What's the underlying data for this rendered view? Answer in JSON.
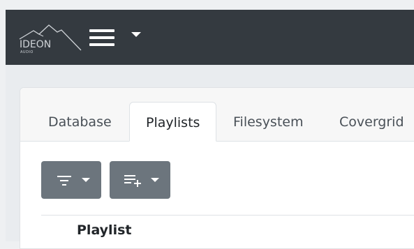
{
  "app": {
    "logo_text": "IDEON",
    "logo_subtext": "AUDIO"
  },
  "navbar": {
    "menu_icon": "hamburger-menu-icon",
    "dropdown_icon": "caret-down-icon"
  },
  "tabs": [
    {
      "label": "Database",
      "active": false
    },
    {
      "label": "Playlists",
      "active": true
    },
    {
      "label": "Filesystem",
      "active": false
    },
    {
      "label": "Covergrid",
      "active": false
    }
  ],
  "toolbar": {
    "filter_icon": "filter-icon",
    "add_to_playlist_icon": "playlist-add-icon"
  },
  "table": {
    "columns": [
      "Playlist"
    ]
  },
  "colors": {
    "navbar": "#343a40",
    "button": "#6c757d",
    "background": "#e9ecef"
  }
}
